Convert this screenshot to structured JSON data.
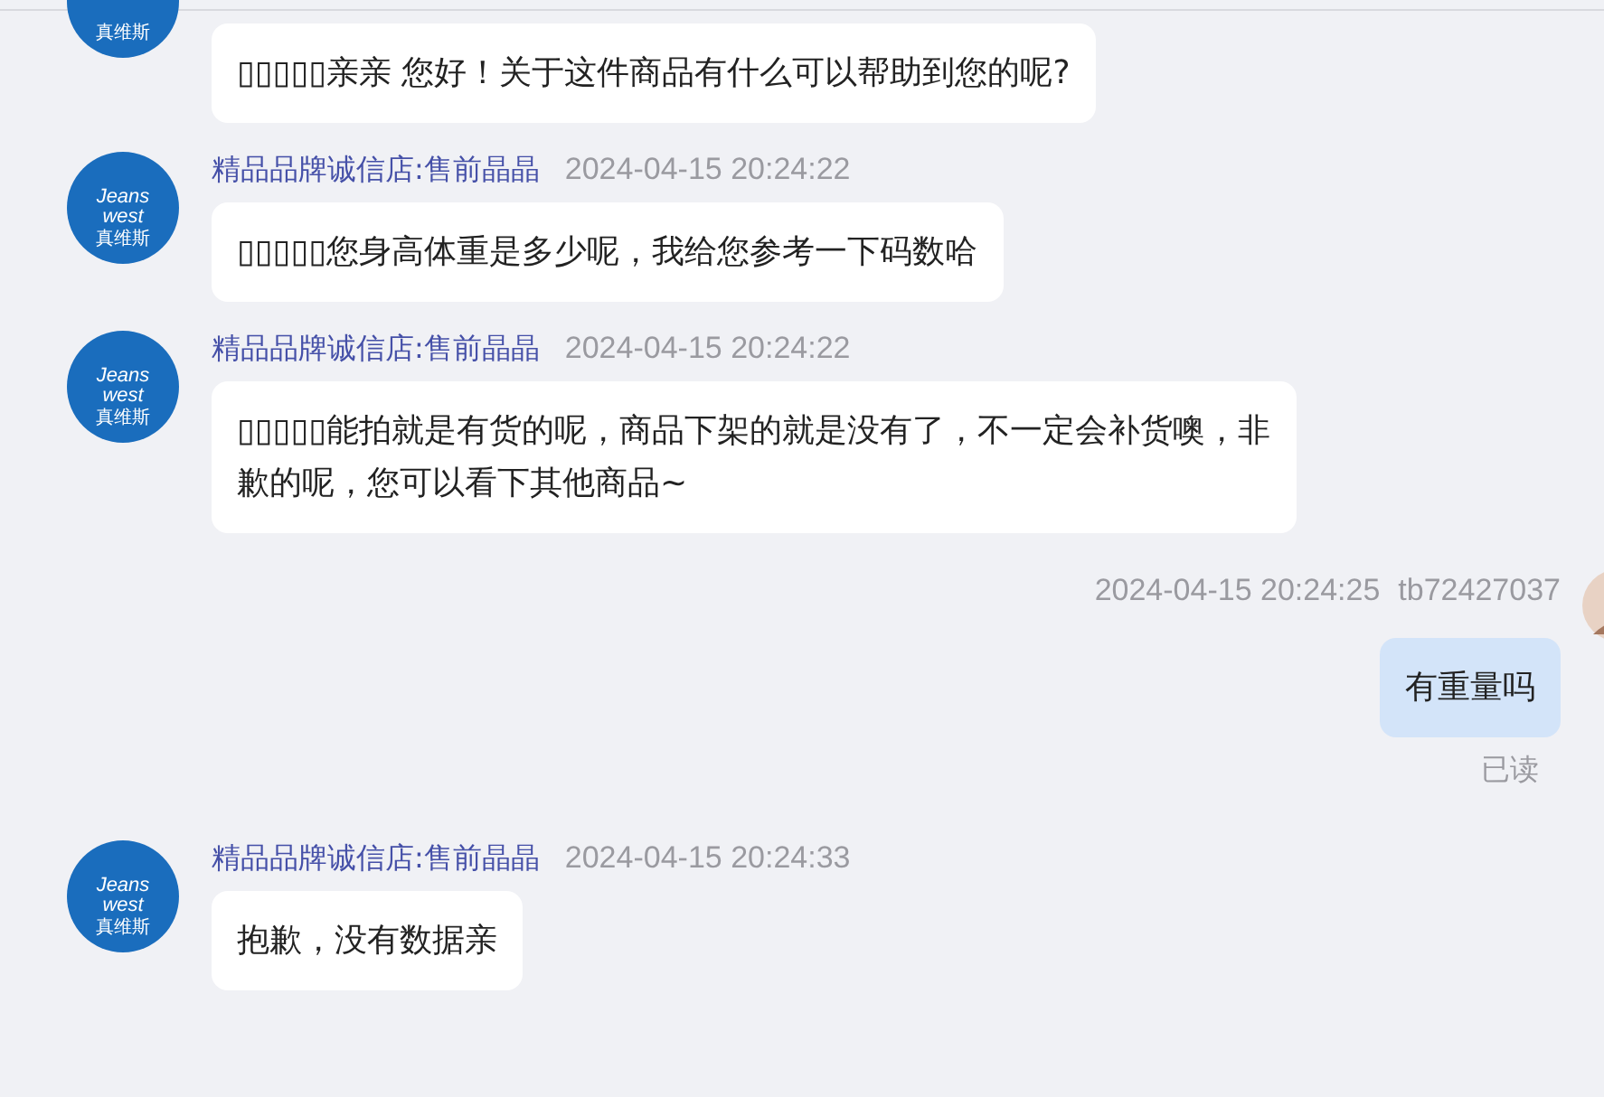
{
  "messages": [
    {
      "kind": "incoming",
      "avatar_text": [
        "真维斯"
      ],
      "lines": [
        "▯▯▯▯▯亲亲 您好！关于这件商品有什么可以帮助到您的呢?"
      ]
    },
    {
      "kind": "incoming",
      "sender": "精品品牌诚信店:售前晶晶",
      "time": "2024-04-15 20:24:22",
      "avatar_text": [
        "Jeans",
        "west",
        "真维斯"
      ],
      "lines": [
        "▯▯▯▯▯您身高体重是多少呢，我给您参考一下码数哈"
      ]
    },
    {
      "kind": "incoming",
      "sender": "精品品牌诚信店:售前晶晶",
      "time": "2024-04-15 20:24:22",
      "avatar_text": [
        "Jeans",
        "west",
        "真维斯"
      ],
      "lines": [
        "▯▯▯▯▯能拍就是有货的呢，商品下架的就是没有了，不一定会补货噢，非",
        "歉的呢，您可以看下其他商品~"
      ]
    },
    {
      "kind": "outgoing",
      "time": "2024-04-15 20:24:25",
      "sender": "tb72427037",
      "lines": [
        "有重量吗"
      ],
      "status": "已读"
    },
    {
      "kind": "incoming",
      "sender": "精品品牌诚信店:售前晶晶",
      "time": "2024-04-15 20:24:33",
      "avatar_text": [
        "Jeans",
        "west",
        "真维斯"
      ],
      "lines": [
        "抱歉，没有数据亲"
      ]
    }
  ]
}
